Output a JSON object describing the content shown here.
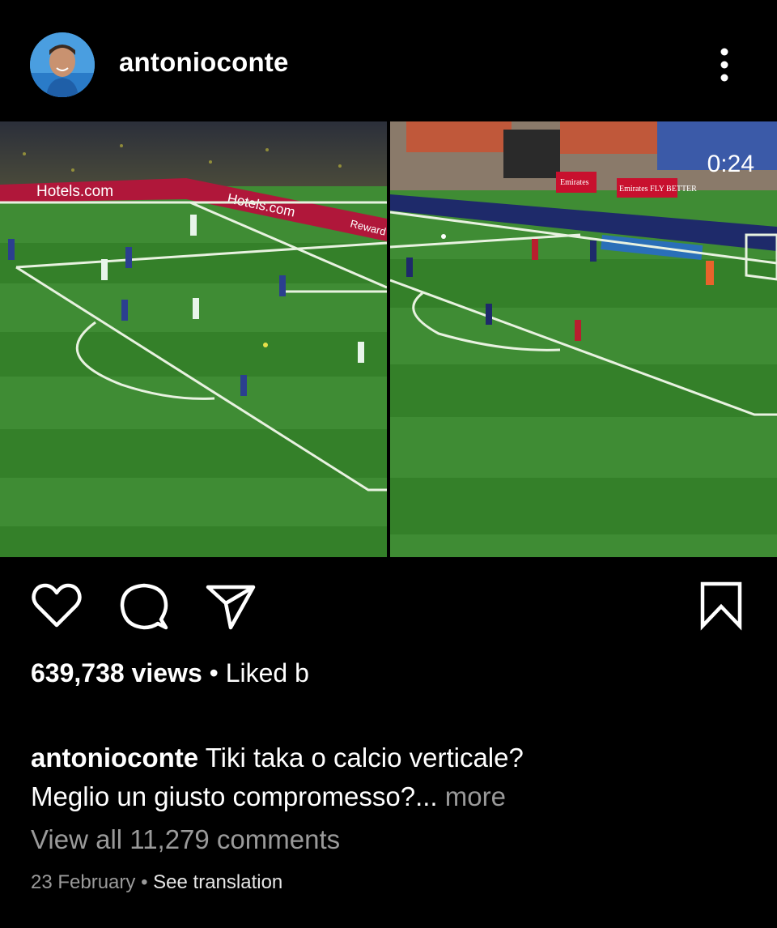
{
  "post": {
    "username": "antonioconte",
    "video_duration": "0:24",
    "ads_left": [
      "Hotels.com",
      "Hotels.com",
      "Reward"
    ],
    "ads_right": [
      "Emirates",
      "Emirates FLY BETTER"
    ],
    "views_count": "639,738 views",
    "liked_by_prefix": " • Liked b",
    "caption_user": "antonioconte",
    "caption_line1": " Tiki taka o calcio verticale?",
    "caption_line2": "Meglio un giusto compromesso?...",
    "caption_more": " more",
    "view_comments": "View all 11,279 comments",
    "date": "23 February",
    "date_separator": " • ",
    "see_translation": "See translation"
  },
  "colors": {
    "background": "#000000",
    "secondary_text": "#9a9a9a",
    "pitch_light": "#3f8c34",
    "pitch_dark": "#2f7a2a"
  },
  "icons": [
    "kebab-menu-icon",
    "heart-icon",
    "comment-icon",
    "share-icon",
    "bookmark-icon"
  ]
}
